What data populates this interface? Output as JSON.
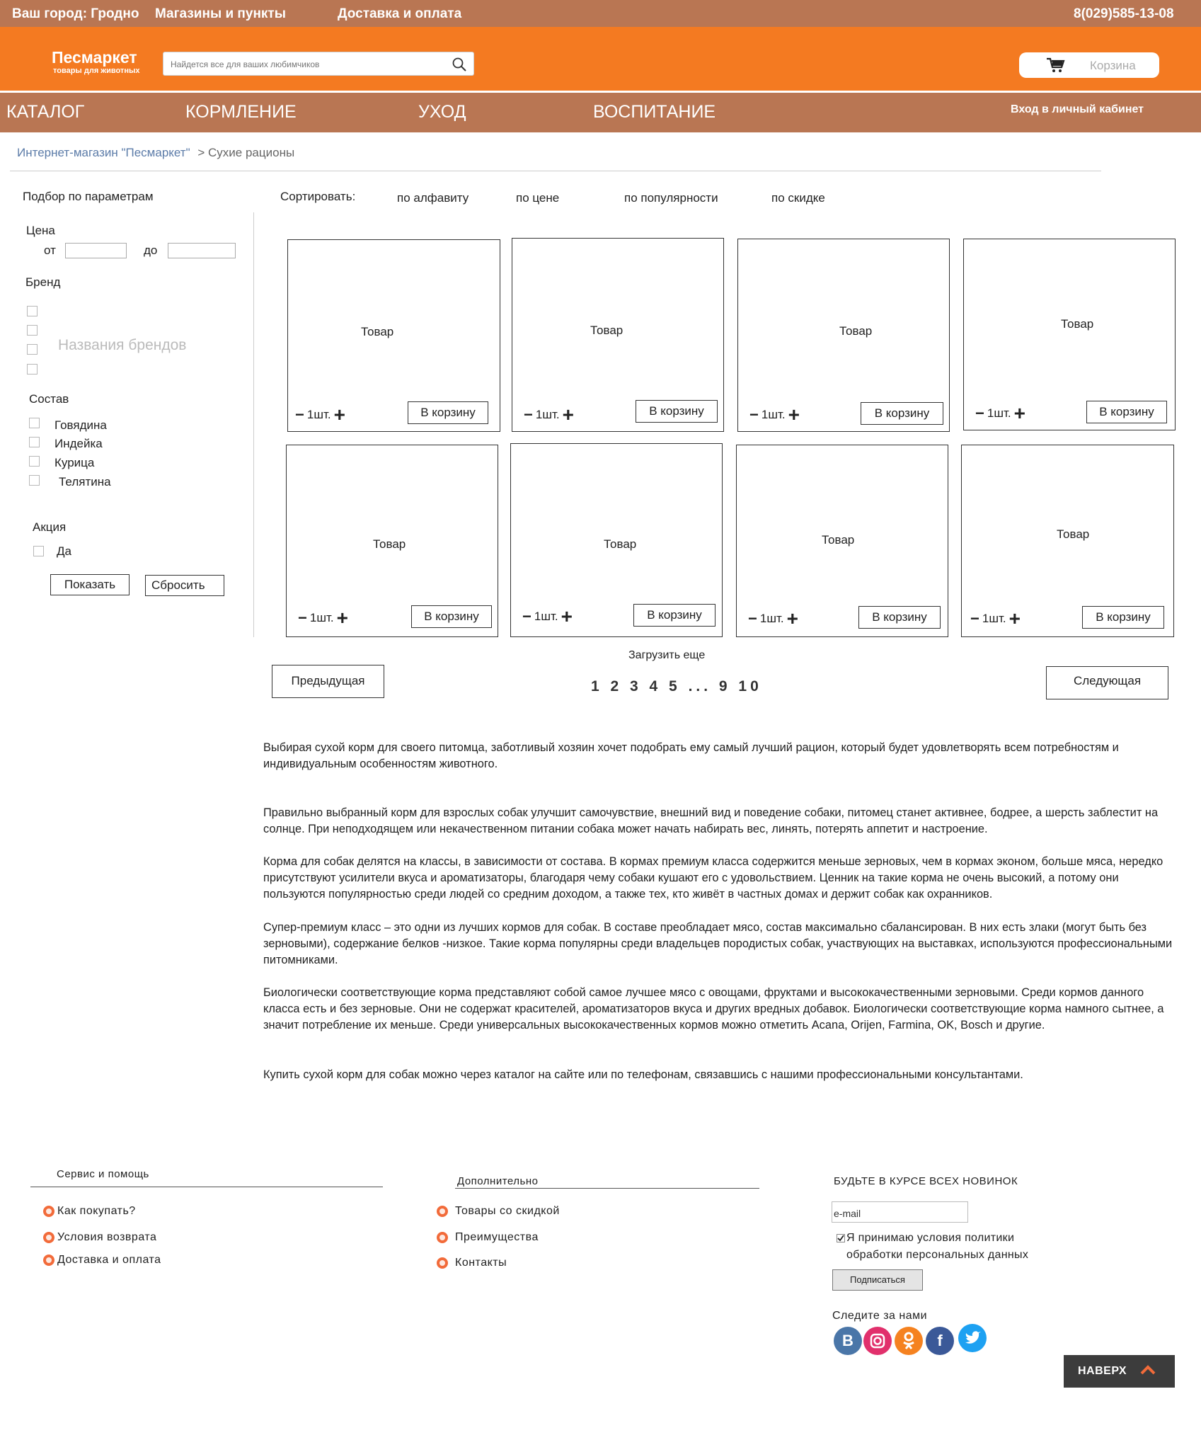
{
  "topbar": {
    "city": "Ваш город: Гродно",
    "stores": "Магазины и пункты",
    "delivery": "Доставка и оплата",
    "phone": "8(029)585-13-08"
  },
  "header": {
    "logo_title": "Песмаркет",
    "logo_subtitle": "товары для животных",
    "search_placeholder": "Найдется все для ваших любимчиков",
    "cart_label": "Корзина"
  },
  "nav": {
    "items": [
      "КАТАЛОГ",
      "КОРМЛЕНИЕ",
      "УХОД",
      "ВОСПИТАНИЕ"
    ],
    "login": "Вход в личный кабинет"
  },
  "breadcrumb": {
    "home": "Интернет-магазин \"Песмаркет\"",
    "separator": ">",
    "current": "Сухие рационы"
  },
  "filters": {
    "title": "Подбор по параметрам",
    "price_label": "Цена",
    "price_from": "от",
    "price_to": "до",
    "brand_label": "Бренд",
    "brand_placeholder": "Названия брендов",
    "composition_label": "Состав",
    "composition": [
      "Говядина",
      "Индейка",
      "Курица",
      "Телятина"
    ],
    "promo_label": "Акция",
    "promo_option": "Да",
    "show_button": "Показать",
    "reset_button": "Сбросить"
  },
  "sort": {
    "label": "Сортировать:",
    "options": [
      "по алфавиту",
      "по цене",
      "по популярности",
      "по скидке"
    ]
  },
  "products": {
    "name": "Товар",
    "qty": "1шт.",
    "to_cart": "В корзину"
  },
  "pagination": {
    "load_more": "Загрузить еще",
    "prev": "Предыдущая",
    "next": "Следующая",
    "pages": "1 2 3 4 5 ... 9 10"
  },
  "article": [
    "Выбирая сухой корм для своего питомца, заботливый хозяин хочет подобрать ему самый лучший рацион, который будет удовлетворять всем потребностям и индивидуальным особенностям животного.",
    "Правильно выбранный корм для взрослых собак улучшит самочувствие, внешний вид и поведение собаки, питомец станет активнее, бодрее, а шерсть заблестит на солнце.  При неподходящем или некачественном питании собака может начать набирать вес, линять, потерять аппетит и настроение.",
    "Корма для собак делятся на классы, в зависимости от состава. В кормах премиум класса содержится меньше зерновых, чем в кормах эконом, больше мяса, нередко присутствуют усилители вкуса и ароматизаторы, благодаря чему собаки кушают его с удовольствием.  Ценник на такие корма не очень высокий, а потому они пользуются популярностью среди людей со средним доходом, а также тех, кто живёт в частных домах и держит собак как охранников.",
    "Супер-премиум класс – это одни из лучших кормов для собак. В составе преобладает мясо, состав максимально сбалансирован. В них есть злаки (могут быть без зерновыми), содержание белков -низкое. Такие корма популярны среди владельцев породистых собак, участвующих на выставках, используются профессиональными питомниками.",
    "Биологически соответствующие корма  представляют собой самое лучшее мясо с овощами, фруктами и высококачественными зерновыми. Среди кормов данного класса есть и без зерновые. Они не содержат красителей, ароматизаторов вкуса и других вредных добавок. Биологически соответствующие корма намного сытнее, а значит потребление их меньше. Среди универсальных высококачественных кормов можно отметить Acana, Orijen, Farmina, OK, Bosch и другие.",
    "Купить сухой корм для собак можно через каталог на сайте или по телефонам, связавшись с нашими профессиональными консультантами."
  ],
  "footer": {
    "service_title": "Сервис и помощь",
    "service_links": [
      "Как покупать?",
      "Условия возврата",
      "Доставка и оплата"
    ],
    "extra_title": "Дополнительно",
    "extra_links": [
      "Товары со скидкой",
      "Преимущества",
      "Контакты"
    ],
    "news_title": "БУДЬТЕ В КУРСЕ ВСЕХ НОВИНОК",
    "email_value": "e-mail",
    "agree_text": "Я принимаю условия политики обработки персональных данных",
    "subscribe": "Подписаться",
    "follow": "Следите за нами",
    "social_icons": [
      "vk-icon",
      "instagram-icon",
      "odnoklassniki-icon",
      "facebook-icon",
      "twitter-icon"
    ],
    "to_top": "НАВЕРХ"
  },
  "colors": {
    "orange": "#f47a21",
    "brown": "#b97653",
    "link_blue": "#5b7ba8"
  }
}
